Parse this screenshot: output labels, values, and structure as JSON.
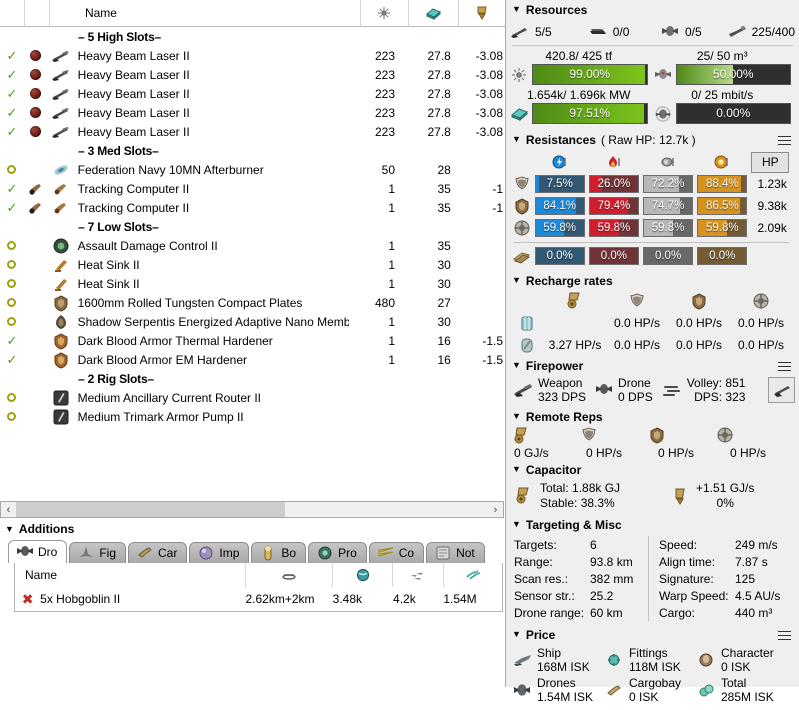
{
  "fitting_table": {
    "columns": [
      {
        "key": "state",
        "icon": ""
      },
      {
        "key": "charge",
        "icon": ""
      },
      {
        "key": "item",
        "icon": ""
      },
      {
        "key": "name",
        "label": "Name"
      },
      {
        "key": "cpu",
        "icon": "cpu-icon"
      },
      {
        "key": "powergrid",
        "icon": "powergrid-icon"
      },
      {
        "key": "capacitor",
        "icon": "capacitor-icon"
      }
    ],
    "groups": [
      {
        "label": "– 5 High Slots–",
        "rows": [
          {
            "state": "online-check",
            "charge": "ammo-orb",
            "icon": "turret-icon",
            "name": "Heavy Beam Laser II",
            "cpu": "223",
            "pg": "27.8",
            "cap": "-3.08"
          },
          {
            "state": "online-check",
            "charge": "ammo-orb",
            "icon": "turret-icon",
            "name": "Heavy Beam Laser II",
            "cpu": "223",
            "pg": "27.8",
            "cap": "-3.08"
          },
          {
            "state": "online-check",
            "charge": "ammo-orb",
            "icon": "turret-icon",
            "name": "Heavy Beam Laser II",
            "cpu": "223",
            "pg": "27.8",
            "cap": "-3.08"
          },
          {
            "state": "online-check",
            "charge": "ammo-orb",
            "icon": "turret-icon",
            "name": "Heavy Beam Laser II",
            "cpu": "223",
            "pg": "27.8",
            "cap": "-3.08"
          },
          {
            "state": "online-check",
            "charge": "ammo-orb",
            "icon": "turret-icon",
            "name": "Heavy Beam Laser II",
            "cpu": "223",
            "pg": "27.8",
            "cap": "-3.08"
          }
        ]
      },
      {
        "label": "– 3 Med Slots–",
        "rows": [
          {
            "state": "offline-ring",
            "charge": "",
            "icon": "afterburner-icon",
            "name": "Federation Navy 10MN Afterburner",
            "cpu": "50",
            "pg": "28",
            "cap": ""
          },
          {
            "state": "online-check",
            "charge": "script-icon",
            "icon": "tracking-icon",
            "name": "Tracking Computer II",
            "cpu": "1",
            "pg": "35",
            "cap": "-1"
          },
          {
            "state": "online-check",
            "charge": "script-icon",
            "icon": "tracking-icon",
            "name": "Tracking Computer II",
            "cpu": "1",
            "pg": "35",
            "cap": "-1"
          }
        ]
      },
      {
        "label": "– 7 Low Slots–",
        "rows": [
          {
            "state": "offline-ring",
            "charge": "",
            "icon": "damage-control-icon",
            "name": "Assault Damage Control II",
            "cpu": "1",
            "pg": "35",
            "cap": ""
          },
          {
            "state": "offline-ring",
            "charge": "",
            "icon": "heatsink-icon",
            "name": "Heat Sink II",
            "cpu": "1",
            "pg": "30",
            "cap": ""
          },
          {
            "state": "offline-ring",
            "charge": "",
            "icon": "heatsink-icon",
            "name": "Heat Sink II",
            "cpu": "1",
            "pg": "30",
            "cap": ""
          },
          {
            "state": "offline-ring",
            "charge": "",
            "icon": "armor-plate-icon",
            "name": "1600mm Rolled Tungsten Compact Plates",
            "cpu": "480",
            "pg": "27",
            "cap": ""
          },
          {
            "state": "offline-ring",
            "charge": "",
            "icon": "membrane-icon",
            "name": "Shadow Serpentis Energized Adaptive Nano Membrane",
            "cpu": "1",
            "pg": "30",
            "cap": ""
          },
          {
            "state": "online-check",
            "charge": "",
            "icon": "hardener-icon",
            "name": "Dark Blood Armor Thermal Hardener",
            "cpu": "1",
            "pg": "16",
            "cap": "-1.5"
          },
          {
            "state": "online-check",
            "charge": "",
            "icon": "hardener-icon",
            "name": "Dark Blood Armor EM Hardener",
            "cpu": "1",
            "pg": "16",
            "cap": "-1.5"
          }
        ]
      },
      {
        "label": "– 2 Rig Slots–",
        "rows": [
          {
            "state": "offline-ring",
            "charge": "",
            "icon": "rig-icon",
            "name": "Medium Ancillary Current Router II",
            "cpu": "",
            "pg": "",
            "cap": ""
          },
          {
            "state": "offline-ring",
            "charge": "",
            "icon": "rig-icon",
            "name": "Medium Trimark Armor Pump II",
            "cpu": "",
            "pg": "",
            "cap": ""
          }
        ]
      }
    ]
  },
  "additions": {
    "title": "Additions",
    "tabs": [
      {
        "label": "Dro",
        "icon": "drone-icon",
        "active": true
      },
      {
        "label": "Fig",
        "icon": "fighter-icon",
        "active": false
      },
      {
        "label": "Car",
        "icon": "cargo-icon",
        "active": false
      },
      {
        "label": "Imp",
        "icon": "implant-icon",
        "active": false
      },
      {
        "label": "Bo",
        "icon": "booster-icon",
        "active": false
      },
      {
        "label": "Pro",
        "icon": "projected-icon",
        "active": false
      },
      {
        "label": "Co",
        "icon": "command-icon",
        "active": false
      },
      {
        "label": "Not",
        "icon": "notes-icon",
        "active": false
      }
    ],
    "table": {
      "headers": [
        {
          "label": "Name"
        },
        {
          "icon": "range-icon"
        },
        {
          "icon": "dps-icon"
        },
        {
          "icon": "speed-icon"
        },
        {
          "icon": "price-icon"
        }
      ],
      "rows": [
        {
          "state": "remove-x",
          "name": "5x Hobgoblin II",
          "range": "2.62km+2km",
          "dps": "3.48k",
          "speed": "4.2k",
          "price": "1.54M"
        }
      ]
    }
  },
  "resources": {
    "title": "Resources",
    "slots": [
      {
        "icon": "turret-slot-icon",
        "value": "5/5"
      },
      {
        "icon": "launcher-slot-icon",
        "value": "0/0"
      },
      {
        "icon": "drone-slot-icon",
        "value": "0/5"
      },
      {
        "icon": "calibration-icon",
        "value": "225/400"
      }
    ],
    "bars": [
      {
        "name": "cpu",
        "label": "420.8/ 425 tf",
        "pct": "99.00%",
        "fill": 99.0,
        "color": "#5ea000",
        "icon": "cpu-icon"
      },
      {
        "name": "dronebay",
        "label": "25/ 50 m³",
        "pct": "50.00%",
        "fill": 50.0,
        "color": "#74a83c",
        "icon": "dronebay-icon"
      },
      {
        "name": "powergrid",
        "label": "1.654k/ 1.696k MW",
        "pct": "97.51%",
        "fill": 97.51,
        "color": "#5ea000",
        "icon": "powergrid-icon"
      },
      {
        "name": "bandwidth",
        "label": "0/ 25 mbit/s",
        "pct": "0.00%",
        "fill": 0,
        "color": "#5ea000",
        "icon": "bandwidth-icon"
      }
    ]
  },
  "resistances": {
    "title": "Resistances",
    "subtitle": "( Raw HP: 12.7k )",
    "hp_button": "HP",
    "damage_types": [
      {
        "name": "em",
        "icon": "em-icon",
        "color": "#1e88d8"
      },
      {
        "name": "thermal",
        "icon": "thermal-icon",
        "color": "#cf1f2e"
      },
      {
        "name": "kinetic",
        "icon": "kinetic-icon",
        "color": "#b8b8b8"
      },
      {
        "name": "explosive",
        "icon": "explosive-icon",
        "color": "#d79320"
      }
    ],
    "layers": [
      {
        "name": "shield",
        "icon": "shield-icon",
        "values": [
          "7.5%",
          "26.0%",
          "72.2%",
          "88.4%"
        ],
        "fills": [
          7.5,
          26.0,
          72.2,
          88.4
        ],
        "hp": "1.23k"
      },
      {
        "name": "armor",
        "icon": "armor-icon",
        "values": [
          "84.1%",
          "79.4%",
          "74.7%",
          "86.5%"
        ],
        "fills": [
          84.1,
          79.4,
          74.7,
          86.5
        ],
        "hp": "9.38k"
      },
      {
        "name": "hull",
        "icon": "hull-icon",
        "values": [
          "59.8%",
          "59.8%",
          "59.8%",
          "59.8%"
        ],
        "fills": [
          59.8,
          59.8,
          59.8,
          59.8
        ],
        "hp": "2.09k"
      }
    ],
    "extra_row": {
      "name": "damage-pattern",
      "icon": "pattern-icon",
      "values": [
        "0.0%",
        "0.0%",
        "0.0%",
        "0.0%"
      ],
      "fills": [
        0,
        0,
        0,
        0
      ],
      "hp": ""
    }
  },
  "recharge": {
    "title": "Recharge rates",
    "col_icons": [
      "capacitor-icon",
      "shield-icon",
      "armor-icon",
      "hull-icon"
    ],
    "rows": [
      {
        "icon": "shield-booster-icon",
        "values": [
          "",
          "0.0 HP/s",
          "0.0 HP/s",
          "0.0 HP/s"
        ]
      },
      {
        "icon": "armor-repper-icon",
        "values": [
          "3.27 HP/s",
          "0.0 HP/s",
          "0.0 HP/s",
          "0.0 HP/s"
        ]
      }
    ]
  },
  "firepower": {
    "title": "Firepower",
    "weapon": {
      "label": "Weapon",
      "value": "323 DPS",
      "icon": "turret-icon"
    },
    "drone": {
      "label": "Drone",
      "value": "0 DPS",
      "icon": "drone-icon"
    },
    "volley": {
      "label": "Volley: 851",
      "value": "DPS: 323",
      "icon": "volley-icon"
    },
    "graph_button_icon": "graph-turret-icon"
  },
  "remote_reps": {
    "title": "Remote Reps",
    "items": [
      {
        "icon": "capacitor-icon",
        "value": "0 GJ/s"
      },
      {
        "icon": "shield-icon",
        "value": "0 HP/s"
      },
      {
        "icon": "armor-icon",
        "value": "0 HP/s"
      },
      {
        "icon": "hull-icon",
        "value": "0 HP/s"
      }
    ]
  },
  "capacitor": {
    "title": "Capacitor",
    "total_label": "Total: 1.88k GJ",
    "stable_label": "Stable: 38.3%",
    "delta_label": "+1.51 GJ/s",
    "delta_pct": "0%",
    "icon_left": "capacitor-icon",
    "icon_right": "capacitor-delta-icon"
  },
  "targeting": {
    "title": "Targeting & Misc",
    "left": [
      {
        "key": "Targets:",
        "value": "6"
      },
      {
        "key": "Range:",
        "value": "93.8 km"
      },
      {
        "key": "Scan res.:",
        "value": "382 mm"
      },
      {
        "key": "Sensor str.:",
        "value": "25.2"
      },
      {
        "key": "Drone range:",
        "value": "60 km"
      }
    ],
    "right": [
      {
        "key": "Speed:",
        "value": "249 m/s"
      },
      {
        "key": "Align time:",
        "value": "7.87 s"
      },
      {
        "key": "Signature:",
        "value": "125"
      },
      {
        "key": "Warp Speed:",
        "value": "4.5 AU/s"
      },
      {
        "key": "Cargo:",
        "value": "440 m³"
      }
    ]
  },
  "price": {
    "title": "Price",
    "items": [
      {
        "label": "Ship",
        "value": "168M ISK",
        "icon": "ship-icon"
      },
      {
        "label": "Fittings",
        "value": "118M ISK",
        "icon": "fittings-icon"
      },
      {
        "label": "Character",
        "value": "0 ISK",
        "icon": "character-icon"
      },
      {
        "label": "Drones",
        "value": "1.54M ISK",
        "icon": "drones-icon"
      },
      {
        "label": "Cargobay",
        "value": "0 ISK",
        "icon": "cargobay-icon"
      },
      {
        "label": "Total",
        "value": "285M ISK",
        "icon": "total-icon"
      }
    ]
  },
  "colors": {
    "em": "#1e88d8",
    "thermal": "#cf1f2e",
    "kinetic": "#b8b8b8",
    "explosive": "#d79320",
    "bar_green": "#5ea000",
    "panel_bg": "#efefef"
  }
}
